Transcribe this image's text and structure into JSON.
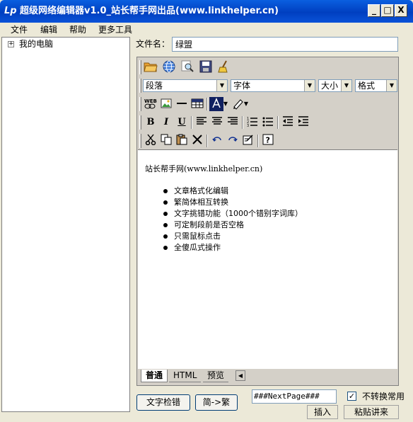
{
  "window": {
    "title": "超级网络编辑器v1.0_站长帮手网出品(www.linkhelper.cn)",
    "app_icon": "Lp",
    "minimize": "_",
    "maximize": "□",
    "close": "X"
  },
  "menu": [
    "文件",
    "编辑",
    "帮助",
    "更多工具"
  ],
  "tree": {
    "expander": "+",
    "root_label": "我的电脑"
  },
  "filename": {
    "label": "文件名：",
    "value": "绿盟"
  },
  "toolbar": {
    "paragraph": "段落",
    "font": "字体",
    "size": "大小",
    "style": "格式",
    "bold": "B",
    "italic": "I",
    "underline": "U"
  },
  "content": {
    "heading": "站长帮手网(www.linkhelper.cn)",
    "bullets": [
      "文章格式化编辑",
      "繁简体相互转换",
      "文字挑错功能（1000个错别字词库）",
      "可定制段前是否空格",
      "只需鼠标点击",
      "全傻瓜式操作"
    ]
  },
  "tabs": [
    "普通",
    "HTML",
    "预览"
  ],
  "bottom": {
    "spellcheck": "文字检错",
    "convert": "简->繁",
    "nextpage_value": "###NextPage###",
    "checkbox_checked": true,
    "checkbox_label": "不转换常用",
    "insert": "插入",
    "paste": "粘贴讲来"
  }
}
